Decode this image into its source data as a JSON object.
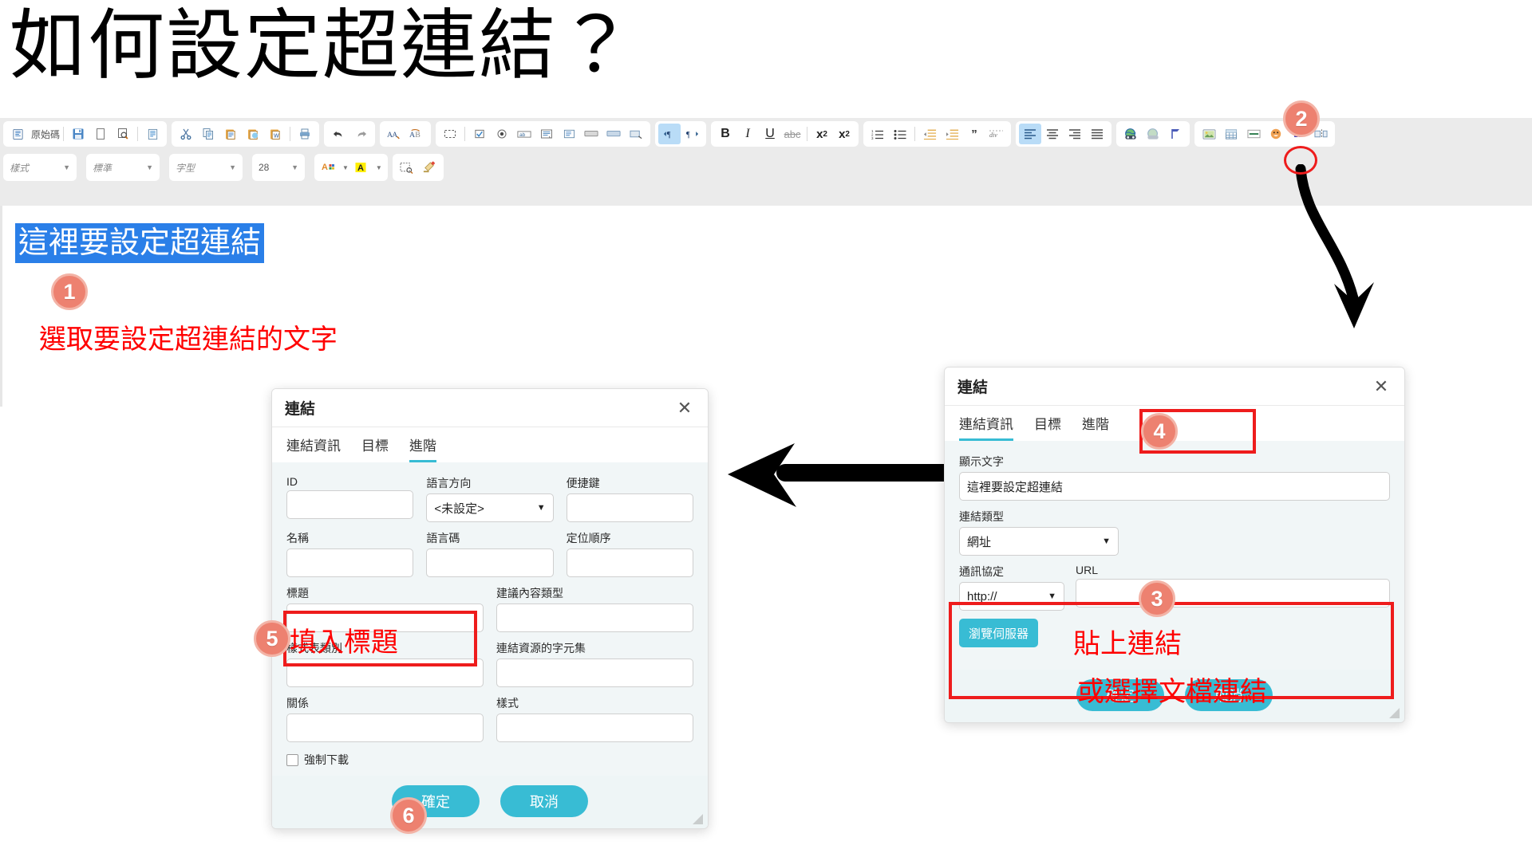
{
  "page": {
    "title": "如何設定超連結？"
  },
  "editor": {
    "toolbar_row1": {
      "source_label": "原始碼",
      "groups": [
        {
          "name": "document",
          "buttons": [
            "source-icon",
            "save-icon",
            "new-page-icon",
            "preview-icon",
            "templates-icon"
          ]
        },
        {
          "name": "clipboard",
          "buttons": [
            "cut-icon",
            "copy-icon",
            "paste-icon",
            "paste-text-icon",
            "paste-word-icon",
            "print-icon"
          ]
        },
        {
          "name": "undo",
          "buttons": [
            "undo-icon",
            "redo-icon"
          ]
        },
        {
          "name": "spell",
          "buttons": [
            "find-icon",
            "replace-icon"
          ]
        },
        {
          "name": "forms",
          "buttons": [
            "select-all-icon",
            "form-icon",
            "checkbox-icon",
            "radio-icon",
            "textfield-icon",
            "textarea-icon",
            "select-icon",
            "button-icon",
            "image-button-icon",
            "hidden-field-icon"
          ]
        },
        {
          "name": "direction",
          "buttons": [
            "ltr-icon",
            "rtl-icon"
          ]
        },
        {
          "name": "basicstyles",
          "buttons": [
            "bold-icon",
            "italic-icon",
            "underline-icon",
            "strike-icon",
            "subscript-icon",
            "superscript-icon"
          ]
        },
        {
          "name": "paragraph",
          "buttons": [
            "numbered-list-icon",
            "bulleted-list-icon",
            "outdent-icon",
            "indent-icon",
            "blockquote-icon",
            "create-div-icon"
          ]
        },
        {
          "name": "align",
          "buttons": [
            "align-left-icon",
            "align-center-icon",
            "align-right-icon",
            "align-justify-icon"
          ]
        },
        {
          "name": "links",
          "buttons": [
            "link-icon",
            "unlink-icon",
            "anchor-icon"
          ]
        },
        {
          "name": "insert",
          "buttons": [
            "image-icon",
            "table-icon",
            "horizontal-rule-icon",
            "smiley-icon",
            "special-char-icon",
            "page-break-icon"
          ]
        }
      ]
    },
    "toolbar_row2": {
      "styles": "樣式",
      "format": "標準",
      "font": "字型",
      "size": "28",
      "text_color_icon": "text-color-icon",
      "bg_color_icon": "background-color-icon",
      "show_blocks_icon": "show-blocks-icon",
      "remove_format_icon": "remove-format-icon"
    },
    "content": {
      "selected_text": "這裡要設定超連結",
      "selection_color": "#2a7fe8"
    }
  },
  "annotations": {
    "badges": [
      {
        "id": "1",
        "label": "1"
      },
      {
        "id": "2",
        "label": "2"
      },
      {
        "id": "3",
        "label": "3"
      },
      {
        "id": "4",
        "label": "4"
      },
      {
        "id": "5",
        "label": "5"
      },
      {
        "id": "6",
        "label": "6"
      }
    ],
    "note_select_text": "選取要設定超連結的文字",
    "note_fill_title": "填入標題",
    "note_paste_link": "貼上連結",
    "note_choose_file": "或選擇文檔連結",
    "highlight_color": "#ee1c1c",
    "badge_color": "#ed8170",
    "note_color": "#ff0000"
  },
  "dialog_advanced": {
    "title": "連結",
    "close_icon": "close-icon",
    "tabs": [
      {
        "label": "連結資訊",
        "active": false
      },
      {
        "label": "目標",
        "active": false
      },
      {
        "label": "進階",
        "active": true
      }
    ],
    "fields": [
      {
        "label": "ID",
        "value": "",
        "type": "text"
      },
      {
        "label": "語言方向",
        "value": "<未設定>",
        "type": "select"
      },
      {
        "label": "便捷鍵",
        "value": "",
        "type": "text"
      },
      {
        "label": "名稱",
        "value": "",
        "type": "text"
      },
      {
        "label": "語言碼",
        "value": "",
        "type": "text"
      },
      {
        "label": "定位順序",
        "value": "",
        "type": "text"
      },
      {
        "label": "標題",
        "value": "",
        "type": "text"
      },
      {
        "label": "建議內容類型",
        "value": "",
        "type": "text"
      },
      {
        "label": "樣式表類別",
        "value": "",
        "type": "text"
      },
      {
        "label": "連結資源的字元集",
        "value": "",
        "type": "text"
      },
      {
        "label": "關係",
        "value": "",
        "type": "text"
      },
      {
        "label": "樣式",
        "value": "",
        "type": "text"
      }
    ],
    "checkbox": {
      "label": "強制下載",
      "checked": false
    },
    "ok_label": "確定",
    "cancel_label": "取消"
  },
  "dialog_link": {
    "title": "連結",
    "close_icon": "close-icon",
    "tabs": [
      {
        "label": "連結資訊",
        "active": true
      },
      {
        "label": "目標",
        "active": false
      },
      {
        "label": "進階",
        "active": false
      }
    ],
    "display_text_label": "顯示文字",
    "display_text_value": "這裡要設定超連結",
    "link_type_label": "連結類型",
    "link_type_value": "網址",
    "protocol_label": "通訊協定",
    "protocol_value": "http://",
    "url_label": "URL",
    "url_value": "",
    "browse_label": "瀏覽伺服器",
    "ok_label": "確定",
    "cancel_label": "取消"
  }
}
